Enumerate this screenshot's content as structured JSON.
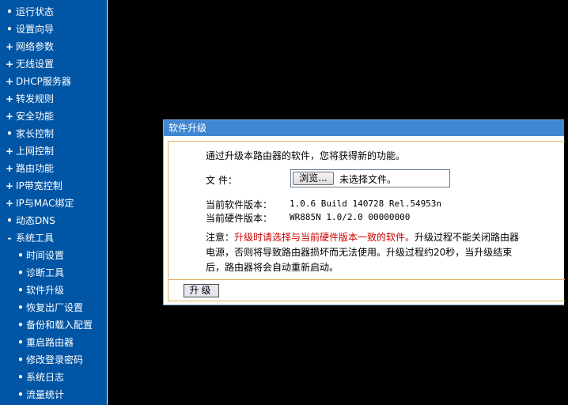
{
  "sidebar": {
    "items": [
      {
        "label": "运行状态",
        "mark": "•"
      },
      {
        "label": "设置向导",
        "mark": "•"
      },
      {
        "label": "网络参数",
        "mark": "+"
      },
      {
        "label": "无线设置",
        "mark": "+"
      },
      {
        "label": "DHCP服务器",
        "mark": "+"
      },
      {
        "label": "转发规则",
        "mark": "+"
      },
      {
        "label": "安全功能",
        "mark": "+"
      },
      {
        "label": "家长控制",
        "mark": "•"
      },
      {
        "label": "上网控制",
        "mark": "+"
      },
      {
        "label": "路由功能",
        "mark": "+"
      },
      {
        "label": "IP带宽控制",
        "mark": "+"
      },
      {
        "label": "IP与MAC绑定",
        "mark": "+"
      },
      {
        "label": "动态DNS",
        "mark": "•"
      },
      {
        "label": "系统工具",
        "mark": "-"
      }
    ],
    "subitems": [
      {
        "label": "时间设置",
        "mark": "•"
      },
      {
        "label": "诊断工具",
        "mark": "•"
      },
      {
        "label": "软件升级",
        "mark": "•"
      },
      {
        "label": "恢复出厂设置",
        "mark": "•"
      },
      {
        "label": "备份和载入配置",
        "mark": "•"
      },
      {
        "label": "重启路由器",
        "mark": "•"
      },
      {
        "label": "修改登录密码",
        "mark": "•"
      },
      {
        "label": "系统日志",
        "mark": "•"
      },
      {
        "label": "流量统计",
        "mark": "•"
      }
    ]
  },
  "panel": {
    "title": "软件升级",
    "intro": "通过升级本路由器的软件，您将获得新的功能。",
    "file_label": "文 件：",
    "browse_label": "浏览...",
    "file_status": "未选择文件。",
    "sw_version_label": "当前软件版本：",
    "sw_version_value": "1.0.6 Build 140728 Rel.54953n",
    "hw_version_label": "当前硬件版本：",
    "hw_version_value": "WR885N 1.0/2.0 00000000",
    "note_prefix": "注意：",
    "note_red": "升级时请选择与当前硬件版本一致的软件。",
    "note_rest": "升级过程不能关闭路由器电源，否则将导致路由器损坏而无法使用。升级过程约20秒，当升级结束后，路由器将会自动重新启动。",
    "upgrade_button": "升级"
  },
  "colors": {
    "sidebar_bg": "#0055a5",
    "header_bg": "#3f87d3",
    "frame_border": "#e2b35a",
    "warning_text": "#cc0000"
  }
}
